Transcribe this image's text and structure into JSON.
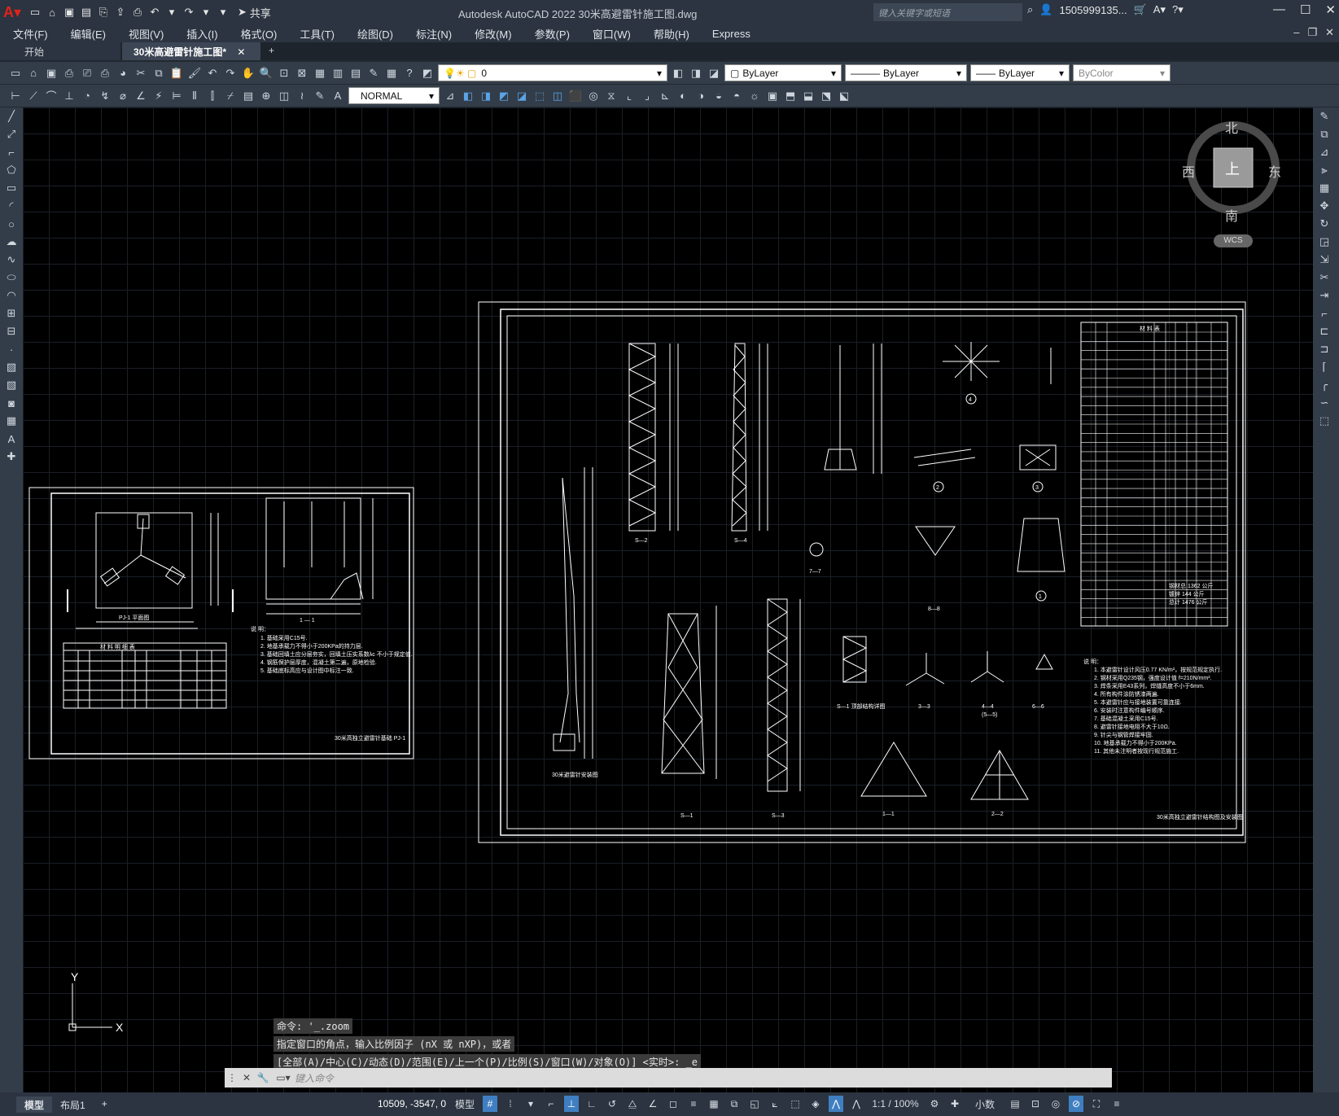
{
  "app": {
    "title": "Autodesk AutoCAD 2022    30米高避雷针施工图.dwg",
    "search_placeholder": "键入关键字或短语",
    "user": "1505999135...",
    "share": "共享"
  },
  "menu": [
    "文件(F)",
    "编辑(E)",
    "视图(V)",
    "插入(I)",
    "格式(O)",
    "工具(T)",
    "绘图(D)",
    "标注(N)",
    "修改(M)",
    "参数(P)",
    "窗口(W)",
    "帮助(H)",
    "Express"
  ],
  "tabs": {
    "start": "开始",
    "doc": "30米高避雷针施工图*",
    "add": "+"
  },
  "toolbar": {
    "layer": "0",
    "color": "ByLayer",
    "linetype": "ByLayer",
    "lineweight": "ByLayer",
    "plotstyle": "ByColor",
    "textstyle": "NORMAL"
  },
  "viewcube": {
    "north": "北",
    "south": "南",
    "east": "东",
    "west": "西",
    "top": "上",
    "wcs": "WCS"
  },
  "ucs": {
    "x": "X",
    "y": "Y"
  },
  "command": {
    "history": [
      "命令: '_.zoom",
      "指定窗口的角点，输入比例因子 (nX 或 nXP)，或者",
      "[全部(A)/中心(C)/动态(D)/范围(E)/上一个(P)/比例(S)/窗口(W)/对象(O)] <实时>: _e"
    ],
    "placeholder": "键入命令"
  },
  "status": {
    "model_tab": "模型",
    "layout_tab": "布局1",
    "add": "+",
    "coords": "10509, -3547, 0",
    "model": "模型",
    "scale": "1:1 / 100%",
    "units": "小数"
  },
  "drawing": {
    "sheet1_title": "30米高独立避雷针基础  PJ-1",
    "sheet1_plan": "PJ-1 平面图",
    "sheet1_section": "1 — 1",
    "sheet1_notes_head": "说 明：",
    "sheet1_notes": [
      "1. 基础采用C15号.",
      "2. 地基承载力不得小于200KPa的持力层.",
      "3. 基础回填土应分层夯实，回填土压实系数λc 不小于规定值.",
      "4. 钢筋保护层厚度，混凝土第二遍，原地检验.",
      "5. 基础底标高应与设计图中标注一致."
    ],
    "sheet1_table_head": "材 料 明 细 表",
    "sheet2_title": "30米高独立避雷针结构图及安装图",
    "views": [
      "S—2",
      "S—4",
      "7—7",
      "8—8",
      "S—1",
      "S—3",
      "3—3",
      "4—4",
      "(5—5)",
      "6—6",
      "1—1",
      "2—2",
      "S—1 顶部结构详图",
      "30米避雷针安装图"
    ],
    "circled": [
      "1",
      "2",
      "3",
      "4",
      "5",
      "6",
      "7"
    ],
    "sheet2_notes_head": "说 明：",
    "sheet2_notes": [
      "1. 本避雷针设计风压0.77 KN/m²，按规范规定执行.",
      "2. 钢材采用Q235钢，强度设计值 f=210N/mm².",
      "3. 焊条采用E43系列，焊缝高度不小于6mm.",
      "4. 所有构件涂防锈漆两遍.",
      "5. 本避雷针应与接地装置可靠连接.",
      "6. 安装时注意构件编号顺序.",
      "7. 基础混凝土采用C15号.",
      "8. 避雷针接地电阻不大于10Ω.",
      "9. 针尖与钢管焊接牢固.",
      "10. 地基承载力不得小于200KPa.",
      "11. 其他未注明者按现行规范施工."
    ],
    "sheet2_table_head": "材 料 表",
    "sheet2_totals": [
      "钢材总 1362 公斤",
      "镀锌 144 公斤",
      "总计 1476 公斤"
    ]
  }
}
